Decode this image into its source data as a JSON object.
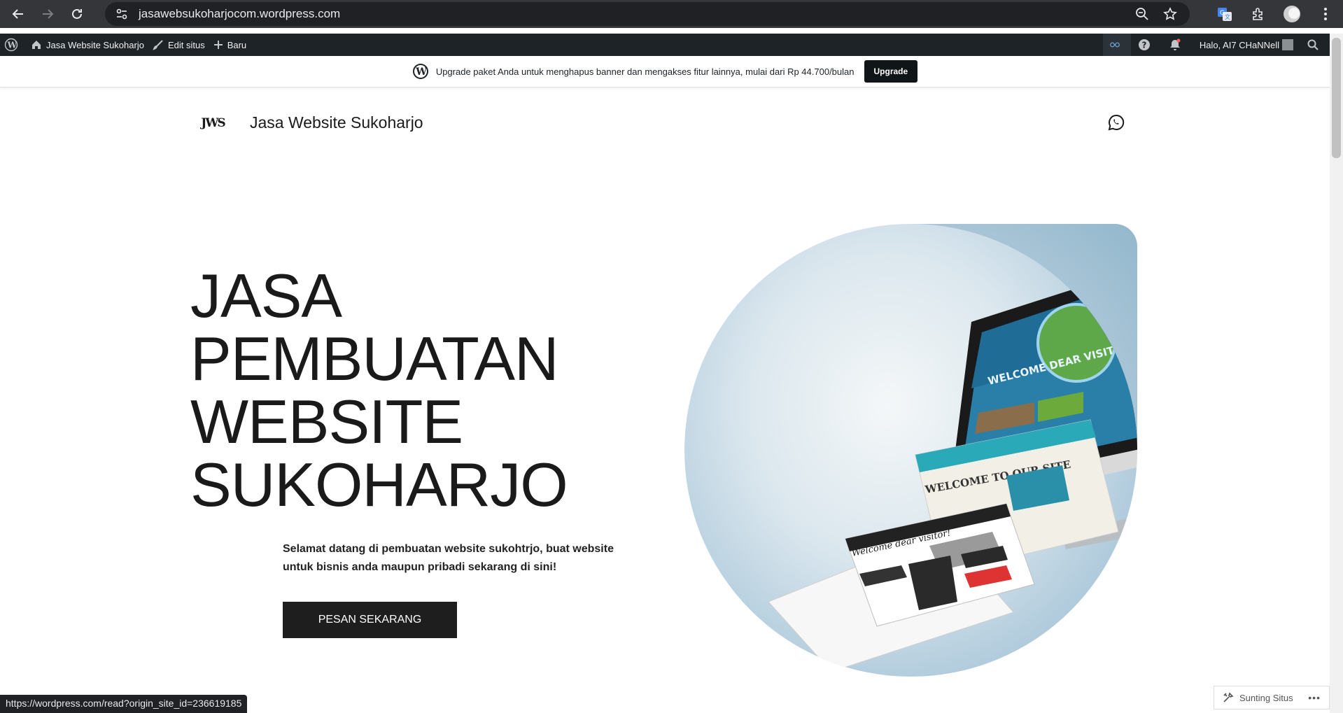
{
  "browser": {
    "url": "jasawebsukoharjocom.wordpress.com",
    "status_url": "https://wordpress.com/read?origin_site_id=236619185"
  },
  "adminbar": {
    "site_name": "Jasa Website Sukoharjo",
    "edit_label": "Edit situs",
    "new_label": "Baru",
    "greeting": "Halo, AI7 CHaNNell"
  },
  "banner": {
    "text": "Upgrade paket Anda untuk menghapus banner dan mengakses fitur lainnya, mulai dari Rp 44.700/bulan",
    "button": "Upgrade"
  },
  "site": {
    "logo_text": "JWS",
    "title": "Jasa Website Sukoharjo"
  },
  "hero": {
    "title_lines": [
      "JASA",
      "PEMBUATAN",
      "WEBSITE",
      "SUKOHARJO"
    ],
    "description": "Selamat datang di pembuatan website sukohtrjo, buat website untuk bisnis anda maupun pribadi sekarang di sini!",
    "cta": "PESAN SEKARANG",
    "image_text_1": "WELCOME DEAR VISITOR",
    "image_text_2": "WELCOME TO OUR SITE",
    "image_text_3": "Welcome dear visitor!"
  },
  "footer_tools": {
    "edit_site": "Sunting Situs"
  },
  "colors": {
    "browser_bg": "#35363a",
    "adminbar_bg": "#1d2327",
    "cta_bg": "#1e1e1e"
  }
}
